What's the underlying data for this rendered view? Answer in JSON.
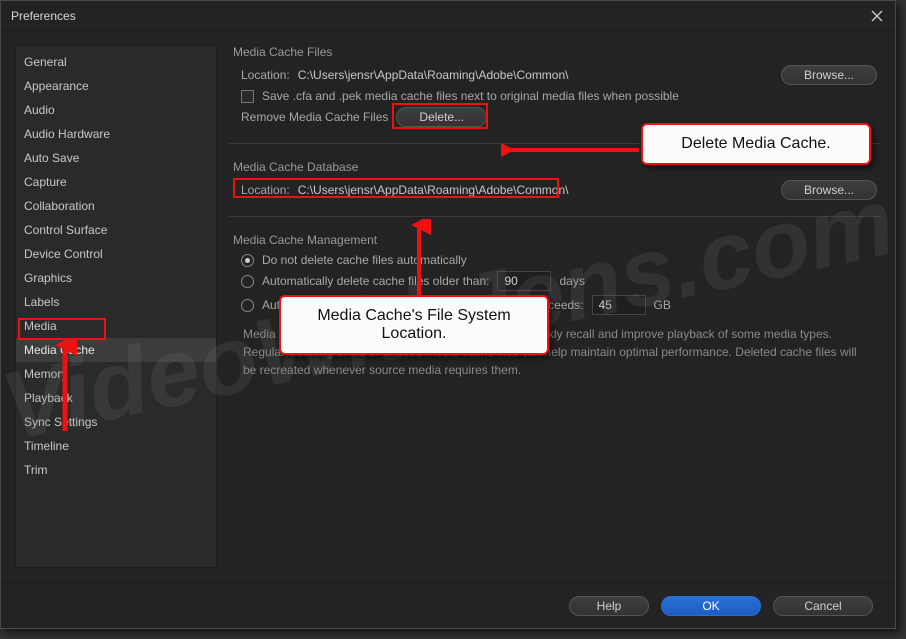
{
  "window": {
    "title": "Preferences"
  },
  "sidebar": {
    "items": [
      "General",
      "Appearance",
      "Audio",
      "Audio Hardware",
      "Auto Save",
      "Capture",
      "Collaboration",
      "Control Surface",
      "Device Control",
      "Graphics",
      "Labels",
      "Media",
      "Media Cache",
      "Memory",
      "Playback",
      "Sync Settings",
      "Timeline",
      "Trim"
    ],
    "selected": "Media Cache"
  },
  "mediaCacheFiles": {
    "group_title": "Media Cache Files",
    "location_label": "Location:",
    "location_path": "C:\\Users\\jensr\\AppData\\Roaming\\Adobe\\Common\\",
    "browse_label": "Browse...",
    "save_next_label": "Save .cfa and .pek media cache files next to original media files when possible",
    "save_next_checked": false,
    "remove_label": "Remove Media Cache Files",
    "delete_label": "Delete..."
  },
  "mediaCacheDatabase": {
    "group_title": "Media Cache Database",
    "location_label": "Location:",
    "location_path": "C:\\Users\\jensr\\AppData\\Roaming\\Adobe\\Common\\",
    "browse_label": "Browse..."
  },
  "mediaCacheManagement": {
    "group_title": "Media Cache Management",
    "opt_no_delete": "Do not delete cache files automatically",
    "opt_age": "Automatically delete cache files older than:",
    "opt_size": "Automatically delete oldest cache files when cache exceeds:",
    "age_value": "90",
    "age_unit": "days",
    "size_value": "45",
    "size_unit": "GB",
    "selected": "no_delete",
    "description": "Media cache files are auto-generated by Premiere to quickly recall and improve playback of some media types.  Regular cleaning of old or unused media cache files can help maintain optimal performance. Deleted cache files will be recreated whenever source media requires them."
  },
  "footer": {
    "help": "Help",
    "ok": "OK",
    "cancel": "Cancel"
  },
  "annotations": {
    "callout_delete": "Delete Media Cache.",
    "callout_location": "Media Cache's File System Location.",
    "watermark": "VideoWithJens.com"
  }
}
